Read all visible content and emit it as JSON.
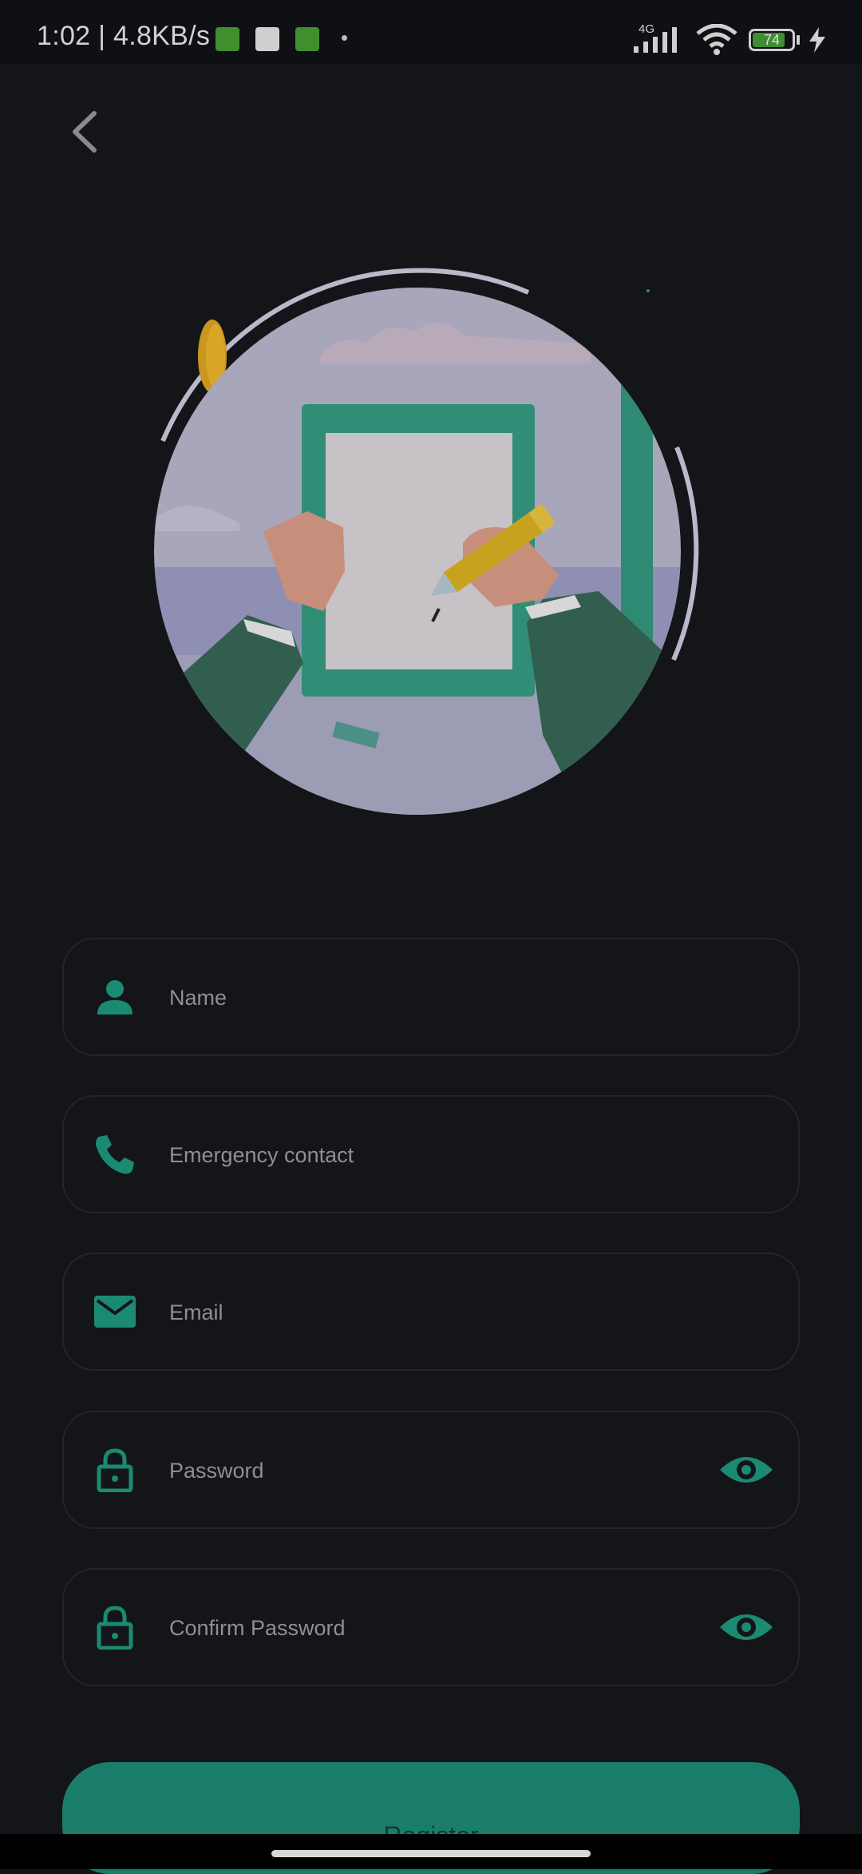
{
  "status_bar": {
    "time_speed": "1:02 | 4.8KB/s",
    "network": "4G",
    "battery": "74"
  },
  "form": {
    "name_placeholder": "Name",
    "emergency_placeholder": "Emergency contact",
    "email_placeholder": "Email",
    "password_placeholder": "Password",
    "confirm_password_placeholder": "Confirm Password"
  },
  "register_label": "Register",
  "colors": {
    "accent": "#1a8a73",
    "background": "#141518"
  }
}
